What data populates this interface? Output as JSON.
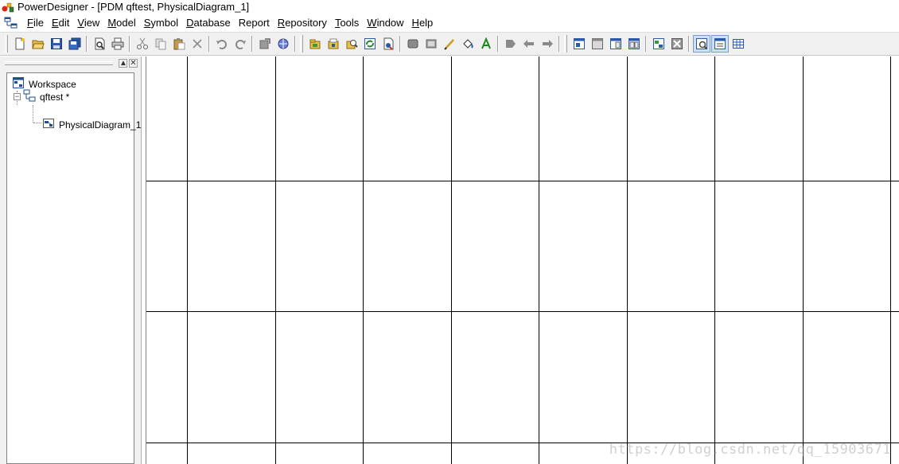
{
  "window": {
    "title": "PowerDesigner - [PDM qftest, PhysicalDiagram_1]"
  },
  "menu": [
    {
      "mnemonic": "F",
      "rest": "ile"
    },
    {
      "mnemonic": "E",
      "rest": "dit"
    },
    {
      "mnemonic": "V",
      "rest": "iew"
    },
    {
      "mnemonic": "M",
      "rest": "odel"
    },
    {
      "mnemonic": "S",
      "rest": "ymbol"
    },
    {
      "mnemonic": "D",
      "rest": "atabase"
    },
    {
      "mnemonic": "R",
      "rest": "eport"
    },
    {
      "mnemonic": "R",
      "rest": "epository"
    },
    {
      "mnemonic": "T",
      "rest": "ools"
    },
    {
      "mnemonic": "W",
      "rest": "indow"
    },
    {
      "mnemonic": "H",
      "rest": "elp"
    }
  ],
  "toolbar": {
    "icons": [
      "new-icon",
      "open-icon",
      "save-icon",
      "save-all-icon",
      "print-preview-icon",
      "print-icon",
      "cut-icon",
      "copy-icon",
      "paste-icon",
      "delete-icon",
      "undo-icon",
      "redo-icon",
      "properties-icon",
      "browse-icon",
      "model-package-icon",
      "check-model-icon",
      "find-icon",
      "impact-analysis-icon",
      "compare-icon",
      "merge-icon",
      "line-style-icon",
      "fill-style-icon",
      "pen-icon",
      "format-painter-icon",
      "font-icon",
      "align-left-icon",
      "align-right-icon",
      "align-up-icon",
      "toolbox-icon",
      "output-icon",
      "result-list-icon",
      "diagram-icon",
      "package-icon",
      "model-icon",
      "workspace-icon",
      "browser-icon",
      "details-icon"
    ],
    "pressed": [
      "browser-icon"
    ]
  },
  "browser": {
    "tree": [
      {
        "label": "Workspace",
        "icon": "workspace-icon",
        "level": 0
      },
      {
        "label": "qftest *",
        "icon": "pdm-model-icon",
        "level": 1,
        "expanded": true
      },
      {
        "label": "PhysicalDiagram_1",
        "icon": "physical-diagram-icon",
        "level": 2
      }
    ]
  },
  "canvas": {
    "watermark": "https://blog.csdn.net/qq_15903671"
  }
}
